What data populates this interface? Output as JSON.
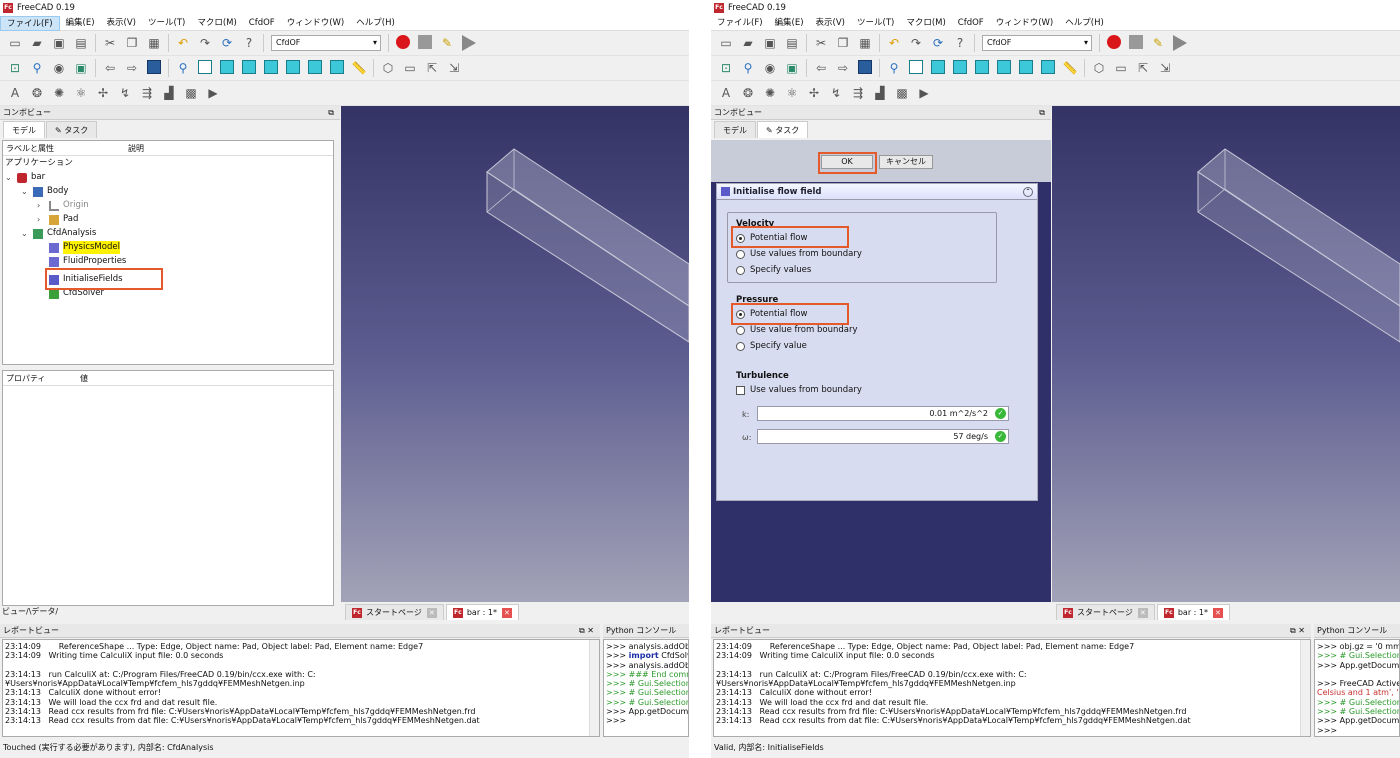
{
  "app_title": "FreeCAD 0.19",
  "menu": [
    "ファイル(F)",
    "編集(E)",
    "表示(V)",
    "ツール(T)",
    "マクロ(M)",
    "CfdOF",
    "ウィンドウ(W)",
    "ヘルプ(H)"
  ],
  "workbench": "CfdOF",
  "combo_view_title": "コンボビュー",
  "tabs": {
    "model": "モデル",
    "task": "タスク"
  },
  "tree": {
    "col_label": "ラベルと属性",
    "col_desc": "説明",
    "app": "アプリケーション",
    "items": [
      "bar",
      "Body",
      "Origin",
      "Pad",
      "CfdAnalysis",
      "PhysicsModel",
      "FluidProperties",
      "InitialiseFields",
      "CfdSolver"
    ]
  },
  "props": {
    "col_prop": "プロパティ",
    "col_value": "値"
  },
  "view_tabs": "ビュー/\\データ/",
  "doc_tabs": {
    "start": "スタートページ",
    "bar": "bar : 1*"
  },
  "report_title": "レポートビュー",
  "report_lines": [
    "23:14:09       ReferenceShape ... Type: Edge, Object name: Pad, Object label: Pad, Element name: Edge7",
    "23:14:09   Writing time CalculiX input file: 0.0 seconds",
    "",
    "23:14:13   run CalculiX at: C:/Program Files/FreeCAD 0.19/bin/ccx.exe with: C:",
    "¥Users¥noris¥AppData¥Local¥Temp¥fcfem_hls7gddq¥FEMMeshNetgen.inp",
    "23:14:13   CalculiX done without error!",
    "23:14:13   We will load the ccx frd and dat result file.",
    "23:14:13   Read ccx results from frd file: C:¥Users¥noris¥AppData¥Local¥Temp¥fcfem_hls7gddq¥FEMMeshNetgen.frd",
    "23:14:13   Read ccx results from dat file: C:¥Users¥noris¥AppData¥Local¥Temp¥fcfem_hls7gddq¥FEMMeshNetgen.dat"
  ],
  "python_title": "Python コンソール",
  "python_left": [
    ">>> analysis.addObje",
    ">>> import CfdSolv",
    ">>> analysis.addObje",
    ">>> ### End comma",
    ">>> # Gui.Selection",
    ">>> # Gui.Selection",
    ">>> # Gui.Selection",
    ">>> App.getDocumen",
    ">>>"
  ],
  "python_right": [
    ">>> obj.gz = '0 mm/s'",
    ">>> # Gui.Selection.a",
    ">>> App.getDocumen",
    "",
    ">>> FreeCAD Active",
    "Celsius and 1 atm', '",
    ">>> # Gui.Selection.a",
    ">>> # Gui.Selection.a",
    ">>> App.getDocumen",
    ">>>"
  ],
  "status_left": "Touched (実行する必要があります), 内部名: CfdAnalysis",
  "status_right": "Valid, 内部名: InitialiseFields",
  "task": {
    "ok": "OK",
    "cancel": "キャンセル",
    "box_title": "Initialise flow field",
    "velocity": "Velocity",
    "vel_opts": [
      "Potential flow",
      "Use values from boundary",
      "Specify values"
    ],
    "pressure": "Pressure",
    "pres_opts": [
      "Potential flow",
      "Use value from boundary",
      "Specify value"
    ],
    "turbulence": "Turbulence",
    "turb_chk": "Use values from boundary",
    "k_label": "k:",
    "k_value": "0.01 m^2/s^2",
    "w_label": "ω:",
    "w_value": "57 deg/s"
  },
  "colors": {
    "highlight": "#e55a2b",
    "yellow": "#fff200",
    "viewport_top": "#333366"
  }
}
